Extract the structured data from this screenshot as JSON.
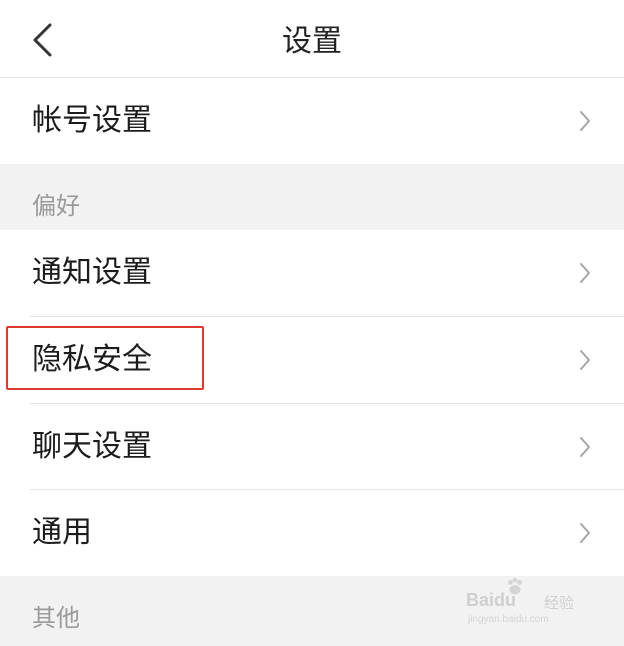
{
  "header": {
    "title": "设置",
    "back_icon": "chevron-left-icon"
  },
  "items": {
    "account": {
      "label": "帐号设置"
    },
    "notifications": {
      "label": "通知设置"
    },
    "privacy": {
      "label": "隐私安全",
      "highlighted": true
    },
    "chat": {
      "label": "聊天设置"
    },
    "general": {
      "label": "通用"
    }
  },
  "sections": {
    "preferences": {
      "title": "偏好"
    },
    "other": {
      "title": "其他"
    }
  },
  "chevron_icon": "chevron-right-icon",
  "watermark": {
    "brand": "Baidu",
    "label": "经验",
    "url": "jingyan.baidu.com"
  },
  "colors": {
    "background": "#ffffff",
    "section_background": "#f2f2f2",
    "highlight_border": "#e03a2e",
    "text_primary": "#1c1c1c",
    "text_secondary": "#9a9a9a"
  }
}
